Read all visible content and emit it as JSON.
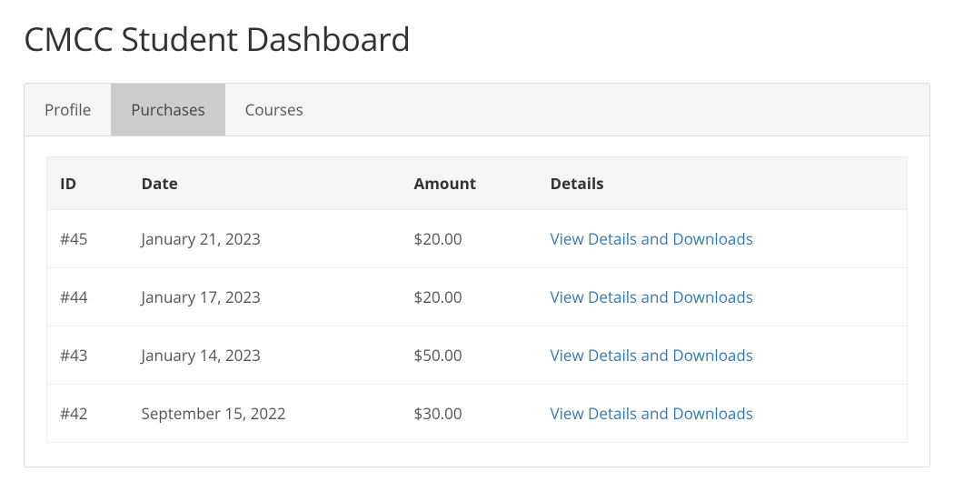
{
  "page": {
    "title": "CMCC Student Dashboard"
  },
  "tabs": [
    {
      "label": "Profile",
      "active": false
    },
    {
      "label": "Purchases",
      "active": true
    },
    {
      "label": "Courses",
      "active": false
    }
  ],
  "table": {
    "headers": {
      "id": "ID",
      "date": "Date",
      "amount": "Amount",
      "details": "Details"
    },
    "rows": [
      {
        "id": "#45",
        "date": "January 21, 2023",
        "amount": "$20.00",
        "details_link": "View Details and Downloads"
      },
      {
        "id": "#44",
        "date": "January 17, 2023",
        "amount": "$20.00",
        "details_link": "View Details and Downloads"
      },
      {
        "id": "#43",
        "date": "January 14, 2023",
        "amount": "$50.00",
        "details_link": "View Details and Downloads"
      },
      {
        "id": "#42",
        "date": "September 15, 2022",
        "amount": "$30.00",
        "details_link": "View Details and Downloads"
      }
    ]
  }
}
